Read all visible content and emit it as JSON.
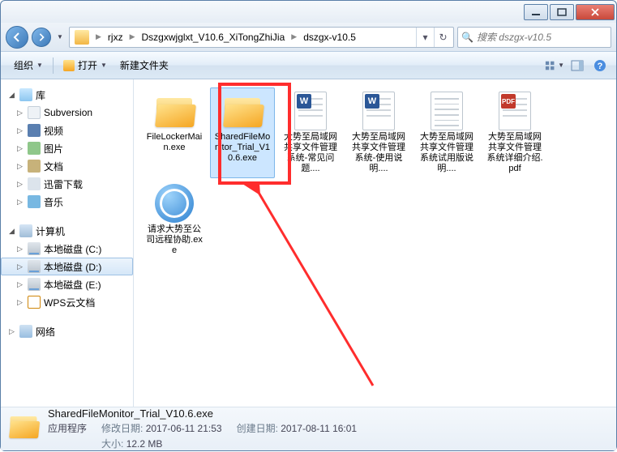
{
  "breadcrumb": {
    "segments": [
      "rjxz",
      "Dszgxwjglxt_V10.6_XiTongZhiJia",
      "dszgx-v10.5"
    ]
  },
  "search": {
    "placeholder": "搜索 dszgx-v10.5"
  },
  "toolbar": {
    "organize": "组织",
    "open": "打开",
    "new_folder": "新建文件夹"
  },
  "tree": {
    "library": {
      "label": "库"
    },
    "subversion": {
      "label": "Subversion"
    },
    "videos": {
      "label": "视频"
    },
    "pictures": {
      "label": "图片"
    },
    "documents": {
      "label": "文档"
    },
    "xunlei": {
      "label": "迅雷下载"
    },
    "music": {
      "label": "音乐"
    },
    "computer": {
      "label": "计算机"
    },
    "drive_c": {
      "label": "本地磁盘 (C:)"
    },
    "drive_d": {
      "label": "本地磁盘 (D:)"
    },
    "drive_e": {
      "label": "本地磁盘 (E:)"
    },
    "wps": {
      "label": "WPS云文档"
    },
    "network": {
      "label": "网络"
    }
  },
  "items": [
    {
      "name": "FileLockerMain.exe",
      "type": "folder"
    },
    {
      "name": "SharedFileMonitor_Trial_V10.6.exe",
      "type": "folder",
      "selected": true
    },
    {
      "name": "大势至局域网共享文件管理系统-常见问题....",
      "type": "word"
    },
    {
      "name": "大势至局域网共享文件管理系统-使用说明....",
      "type": "word"
    },
    {
      "name": "大势至局域网共享文件管理系统试用版说明....",
      "type": "plain"
    },
    {
      "name": "大势至局域网共享文件管理系统详细介绍.pdf",
      "type": "pdf"
    },
    {
      "name": "请求大势至公司远程协助.exe",
      "type": "teamviewer"
    }
  ],
  "details": {
    "name": "SharedFileMonitor_Trial_V10.6.exe",
    "type_label": "应用程序",
    "modified_label": "修改日期:",
    "modified": "2017-06-11 21:53",
    "created_label": "创建日期:",
    "created": "2017-08-11 16:01",
    "size_label": "大小:",
    "size": "12.2 MB"
  }
}
